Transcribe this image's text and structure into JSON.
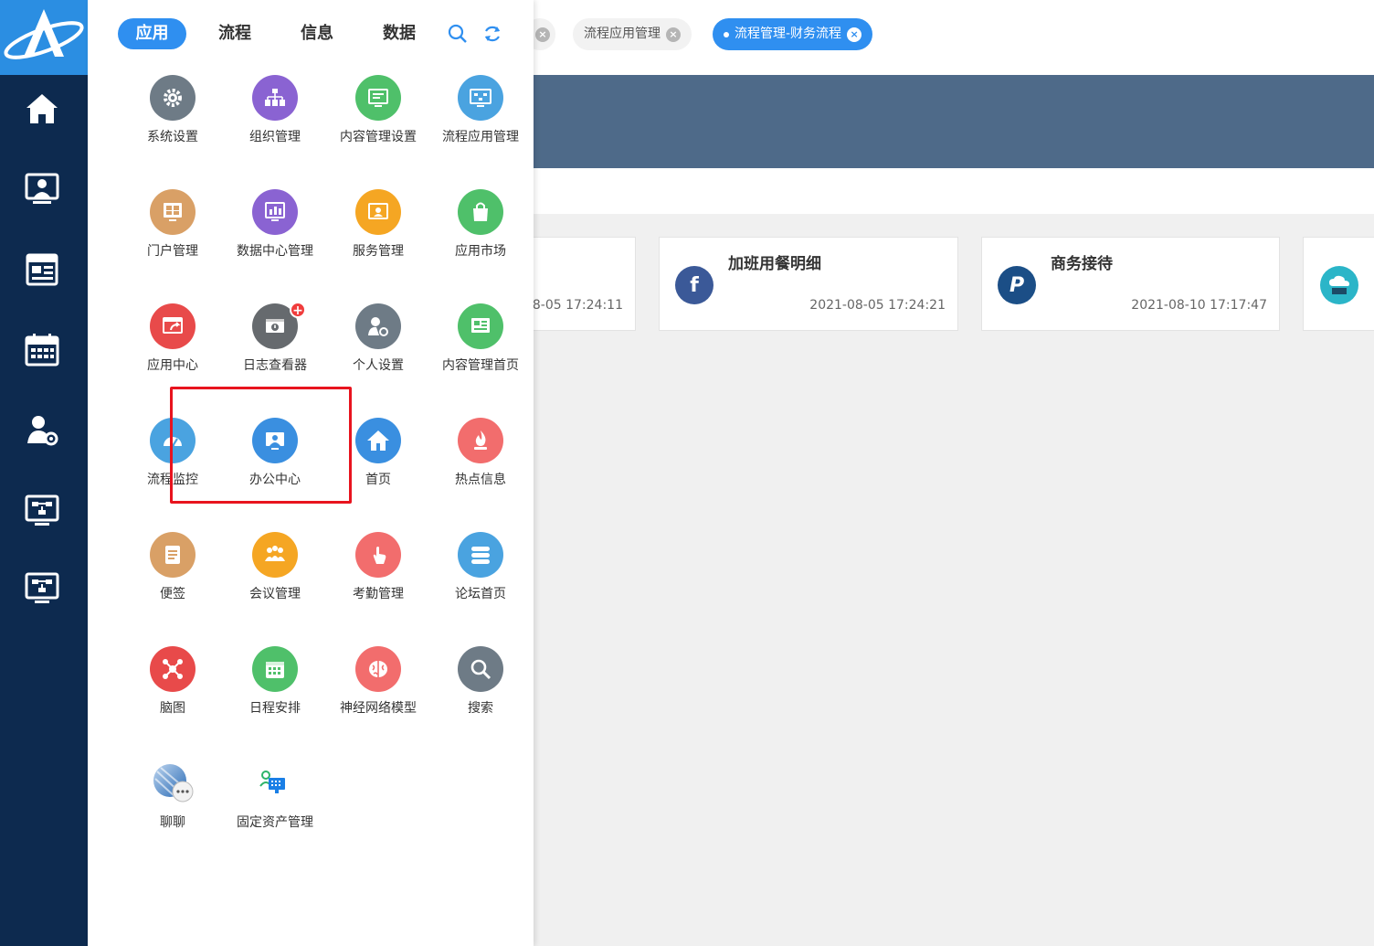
{
  "colors": {
    "sidebar": "#0d2a4f",
    "logo": "#2b8ee2",
    "accent": "#2f8ff0",
    "banner": "#4e6a89",
    "highlight": "#e8141e"
  },
  "sidebar": {
    "items": [
      {
        "name": "home-icon"
      },
      {
        "name": "office-icon"
      },
      {
        "name": "news-icon"
      },
      {
        "name": "calendar-icon"
      },
      {
        "name": "user-settings-icon"
      },
      {
        "name": "workflow-monitor-icon"
      },
      {
        "name": "workflow-monitor-icon-2"
      }
    ]
  },
  "top_tabs": [
    {
      "label": "",
      "close": "×"
    },
    {
      "label": "流程应用管理",
      "close": "×"
    },
    {
      "label": "流程管理-财务流程",
      "close": "×",
      "active": true
    }
  ],
  "panel": {
    "tabs": [
      {
        "label": "应用",
        "active": true
      },
      {
        "label": "流程"
      },
      {
        "label": "信息"
      },
      {
        "label": "数据"
      }
    ],
    "tools": [
      {
        "name": "search-icon"
      },
      {
        "name": "refresh-icon"
      }
    ],
    "apps": [
      {
        "label": "系统设置",
        "icon": "gear-icon",
        "color": "#6e7b86"
      },
      {
        "label": "组织管理",
        "icon": "org-chart-icon",
        "color": "#8a63d2"
      },
      {
        "label": "内容管理设置",
        "icon": "content-settings-icon",
        "color": "#4fc06a"
      },
      {
        "label": "流程应用管理",
        "icon": "workflow-app-icon",
        "color": "#4aa3e0"
      },
      {
        "label": "门户管理",
        "icon": "portal-icon",
        "color": "#d9a066"
      },
      {
        "label": "数据中心管理",
        "icon": "data-center-icon",
        "color": "#8a63d2"
      },
      {
        "label": "服务管理",
        "icon": "service-icon",
        "color": "#f5a623"
      },
      {
        "label": "应用市场",
        "icon": "shopping-bag-icon",
        "color": "#4fc06a"
      },
      {
        "label": "应用中心",
        "icon": "app-center-icon",
        "color": "#e84a4a"
      },
      {
        "label": "日志查看器",
        "icon": "log-viewer-icon",
        "color": "#666a6e",
        "badge": "+"
      },
      {
        "label": "个人设置",
        "icon": "personal-settings-icon",
        "color": "#6e7b86"
      },
      {
        "label": "内容管理首页",
        "icon": "content-home-icon",
        "color": "#4fc06a"
      },
      {
        "label": "流程监控",
        "icon": "speedometer-icon",
        "color": "#4aa3e0"
      },
      {
        "label": "办公中心",
        "icon": "office-center-icon",
        "color": "#3a8fe0"
      },
      {
        "label": "首页",
        "icon": "house-icon",
        "color": "#3a8fe0"
      },
      {
        "label": "热点信息",
        "icon": "flame-icon",
        "color": "#f26d6d"
      },
      {
        "label": "便签",
        "icon": "notepad-icon",
        "color": "#d9a066"
      },
      {
        "label": "会议管理",
        "icon": "meeting-icon",
        "color": "#f5a623"
      },
      {
        "label": "考勤管理",
        "icon": "touch-icon",
        "color": "#f26d6d"
      },
      {
        "label": "论坛首页",
        "icon": "forum-icon",
        "color": "#4aa3e0"
      },
      {
        "label": "脑图",
        "icon": "mind-map-icon",
        "color": "#e84a4a"
      },
      {
        "label": "日程安排",
        "icon": "schedule-icon",
        "color": "#4fc06a"
      },
      {
        "label": "神经网络模型",
        "icon": "brain-icon",
        "color": "#f26d6d"
      },
      {
        "label": "搜索",
        "icon": "magnifier-icon",
        "color": "#6e7b86"
      },
      {
        "label": "聊聊",
        "icon": "chat-icon",
        "color": "#3a7fc8"
      },
      {
        "label": "固定资产管理",
        "icon": "fixed-asset-icon",
        "color": "#2f8ff0"
      }
    ]
  },
  "cards": [
    {
      "title": "",
      "time": "8-05 17:24:11"
    },
    {
      "title": "加班用餐明细",
      "time": "2021-08-05 17:24:21",
      "icon": "facebook-icon",
      "glyph": "f",
      "color": "#3b5998"
    },
    {
      "title": "商务接待",
      "time": "2021-08-10 17:17:47",
      "icon": "paypal-icon",
      "glyph": "P",
      "color": "#1b4e86"
    },
    {
      "title": "",
      "time": "",
      "icon": "cloud-server-icon",
      "color": "#2bb5c8"
    }
  ]
}
